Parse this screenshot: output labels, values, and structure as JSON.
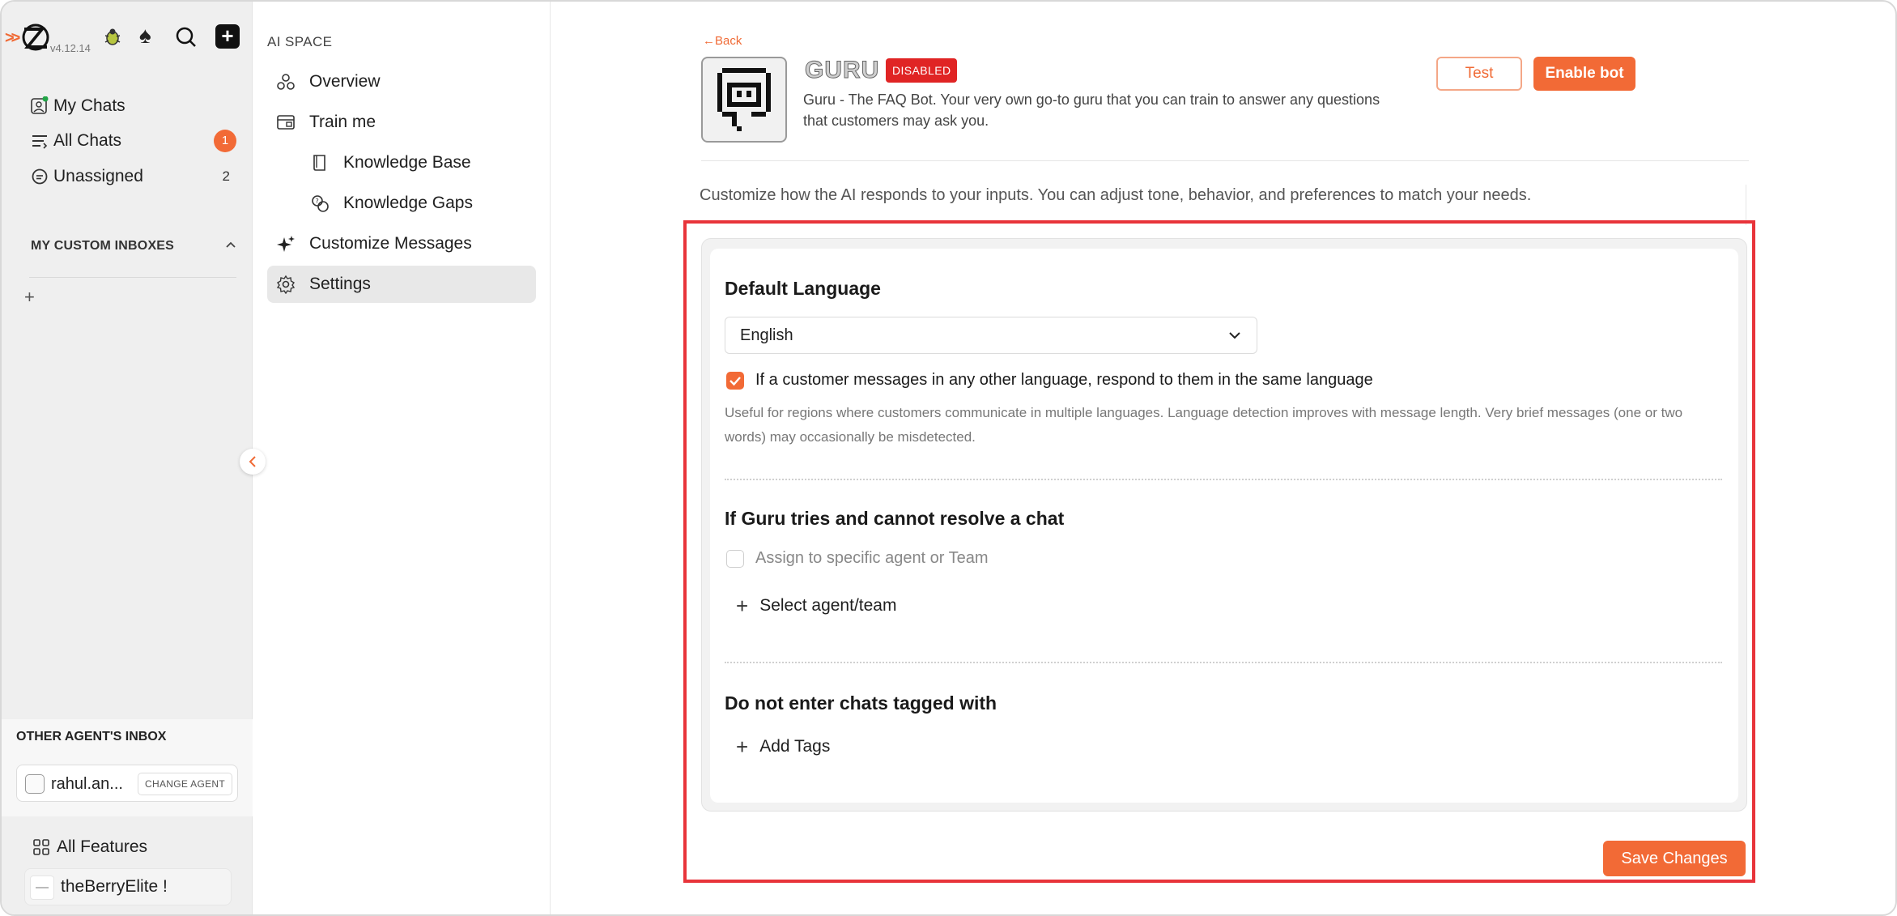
{
  "rail": {
    "version": "v4.12.14",
    "nav": [
      {
        "label": "My Chats",
        "badge": ""
      },
      {
        "label": "All Chats",
        "badge": "1"
      },
      {
        "label": "Unassigned",
        "count": "2"
      }
    ],
    "custom_inboxes_heading": "MY CUSTOM INBOXES",
    "add_symbol": "+",
    "other_agents_heading": "OTHER AGENT'S INBOX",
    "agent_name": "rahul.an...",
    "change_agent_label": "CHANGE AGENT",
    "all_features_label": "All Features",
    "team_name": "theBerryElite !",
    "accent_color": "#f26a36"
  },
  "ai_space": {
    "heading": "AI SPACE",
    "items": [
      {
        "label": "Overview",
        "icon": "overview-icon"
      },
      {
        "label": "Train me",
        "icon": "train-icon"
      },
      {
        "label": "Knowledge Base",
        "icon": "book-icon"
      },
      {
        "label": "Knowledge Gaps",
        "icon": "gaps-icon"
      },
      {
        "label": "Customize Messages",
        "icon": "sparkle-icon"
      },
      {
        "label": "Settings",
        "icon": "gear-icon"
      }
    ],
    "active": "Settings"
  },
  "bot": {
    "back_label": "←Back",
    "name": "GURU",
    "status": "DISABLED",
    "description": "Guru - The FAQ Bot. Your very own go-to guru that you can train to answer any questions that customers may ask you.",
    "test_label": "Test",
    "enable_label": "Enable bot"
  },
  "settings": {
    "intro": "Customize how the AI responds to your inputs. You can adjust tone, behavior, and preferences to match your needs.",
    "default_language_heading": "Default Language",
    "language_value": "English",
    "same_language_label": "If a customer messages in any other language, respond to them in the same language",
    "same_language_checked": true,
    "language_hint": "Useful for regions where customers communicate in multiple languages. Language detection improves with message length. Very brief messages (one or two words) may occasionally be misdetected.",
    "unresolved_heading": "If Guru tries and cannot resolve a chat",
    "assign_label": "Assign to specific agent or Team",
    "assign_checked": false,
    "select_agent_label": "Select agent/team",
    "tags_heading": "Do not enter chats tagged with",
    "add_tags_label": "Add Tags",
    "save_label": "Save Changes"
  }
}
